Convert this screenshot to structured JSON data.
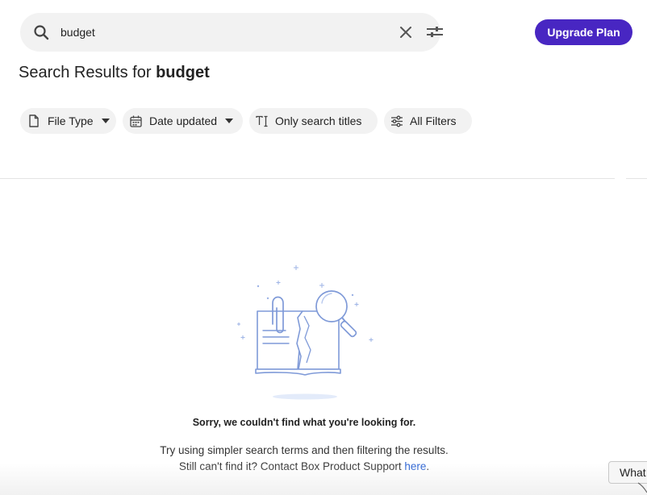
{
  "search": {
    "query": "budget",
    "search_icon": "search-icon",
    "clear_icon": "close-icon",
    "filter_icon": "sliders-icon"
  },
  "header": {
    "upgrade_label": "Upgrade Plan",
    "accent_color": "#4826c2"
  },
  "results": {
    "title_prefix": "Search Results for ",
    "title_query": "budget"
  },
  "filters": [
    {
      "label": "File Type",
      "icon": "file-icon",
      "dropdown": true
    },
    {
      "label": "Date updated",
      "icon": "calendar-icon",
      "dropdown": true
    },
    {
      "label": "Only search titles",
      "icon": "text-cursor-icon",
      "dropdown": false
    },
    {
      "label": "All Filters",
      "icon": "sliders-icon",
      "dropdown": false
    }
  ],
  "empty_state": {
    "illustration": "notebook-magnifier-illustration",
    "title": "Sorry, we couldn't find what you're looking for.",
    "body": "Try using simpler search terms and then filtering the results. Still can't find it? Contact Box Product Support ",
    "link_label": "here",
    "trailing": "."
  },
  "help_tab": {
    "label": "What"
  }
}
